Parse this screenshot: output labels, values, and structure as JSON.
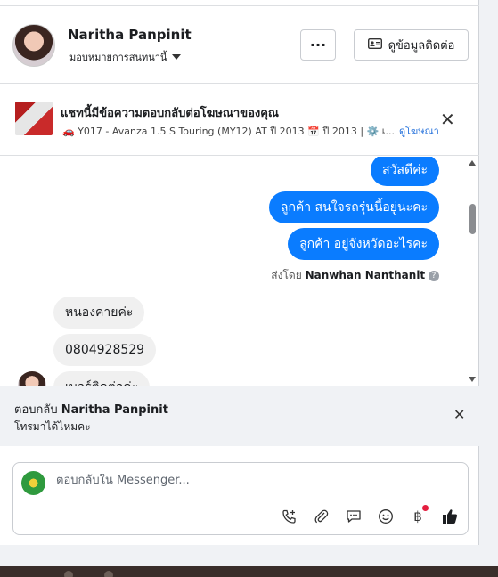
{
  "header": {
    "name": "Naritha Panpinit",
    "assign_label": "มอบหมายการสนทนานี้",
    "more_label": "···",
    "contact_label": "ดูข้อมูลติดต่อ"
  },
  "ad_banner": {
    "title": "แชทนี้มีข้อความตอบกลับต่อโฆษณาของคุณ",
    "description": "🚗 Y017 - Avanza 1.5 S Touring (MY12) AT ปี 2013 📅 ปี 2013 | ⚙️ เ...",
    "link_label": "ดูโฆษณา"
  },
  "thread": {
    "outgoing": [
      "สวัสดีค่ะ",
      "ลูกค้า สนใจรถรุ่นนี้อยู่นะคะ",
      "ลูกค้า อยู่จังหวัดอะไรคะ"
    ],
    "sent_by_prefix": "ส่งโดย",
    "sent_by_name": "Nanwhan Nanthanit",
    "incoming": [
      "หนองคายค่ะ",
      "0804928529",
      "เบอร์ติดต่อค่ะ"
    ]
  },
  "reply": {
    "prefix": "ตอบกลับ",
    "name": "Naritha Panpinit",
    "quoted": "โทรมาได้ไหมคะ"
  },
  "composer": {
    "placeholder": "ตอบกลับใน Messenger...",
    "tools": [
      "phone-add-icon",
      "attachment-icon",
      "saved-reply-icon",
      "emoji-icon",
      "baht-icon",
      "like-icon"
    ]
  },
  "colors": {
    "outgoing_bubble": "#0a7cff",
    "incoming_bubble": "#f0f0f0",
    "link": "#216fdb",
    "notification_dot": "#e41e3f"
  }
}
